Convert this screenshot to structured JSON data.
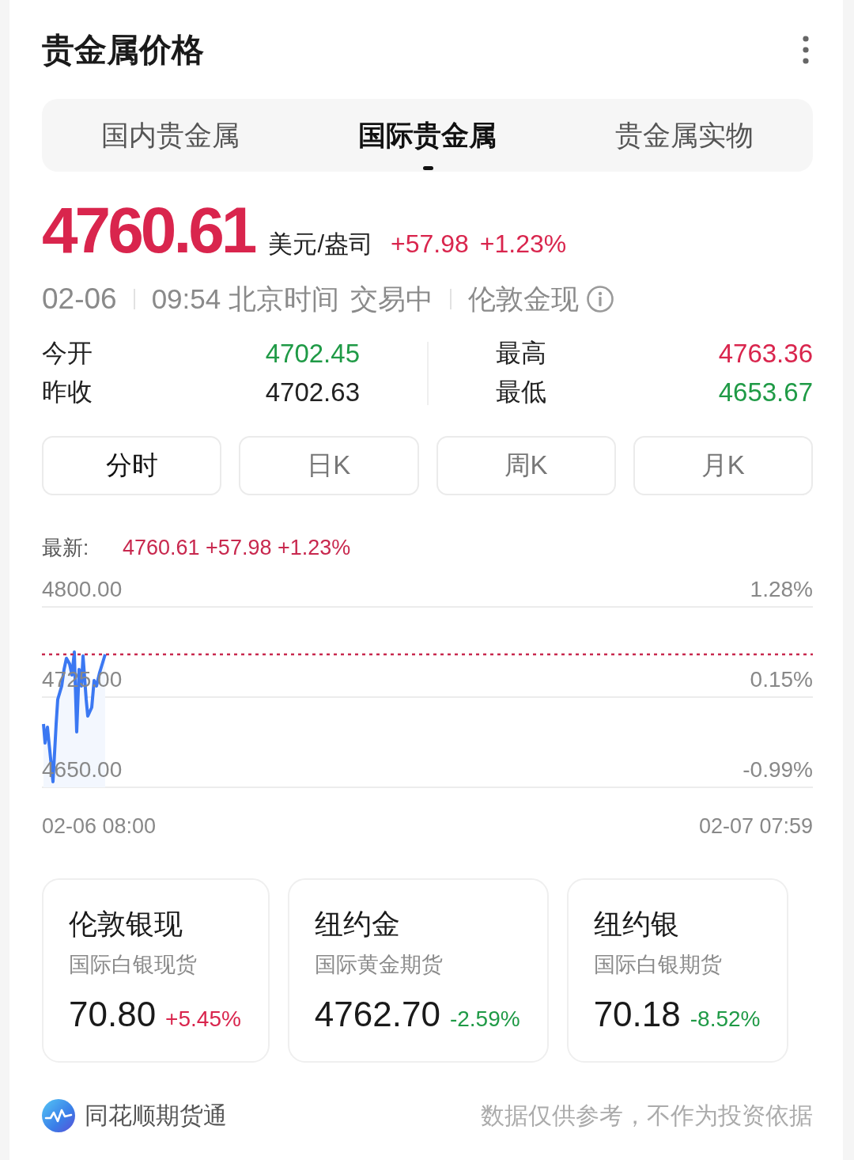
{
  "header": {
    "title": "贵金属价格"
  },
  "tabs": [
    {
      "label": "国内贵金属",
      "selected": false
    },
    {
      "label": "国际贵金属",
      "selected": true
    },
    {
      "label": "贵金属实物",
      "selected": false
    }
  ],
  "quote": {
    "price": "4760.61",
    "unit": "美元/盎司",
    "change": "+57.98",
    "change_percent": "+1.23%"
  },
  "status_line": {
    "date": "02-06",
    "time": "09:54 北京时间",
    "status": "交易中",
    "market": "伦敦金现"
  },
  "stat_columns": [
    {
      "items": [
        {
          "label": "今开",
          "value": "4702.45",
          "color": "#1f9a46"
        },
        {
          "label": "昨收",
          "value": "4702.63",
          "color": "#222222"
        }
      ]
    },
    {
      "items": [
        {
          "label": "最高",
          "value": "4763.36",
          "color": "#d9254d"
        },
        {
          "label": "最低",
          "value": "4653.67",
          "color": "#1f9a46"
        }
      ]
    }
  ],
  "periods": [
    {
      "label": "分时",
      "selected": true
    },
    {
      "label": "日K",
      "selected": false
    },
    {
      "label": "周K",
      "selected": false
    },
    {
      "label": "月K",
      "selected": false
    }
  ],
  "chart": {
    "latest_label": "最新:",
    "latest_value": "4760.61 +57.98 +1.23%",
    "price_axis_labels": [
      "4800.00",
      "4725.00",
      "4650.00"
    ],
    "percent_axis_labels": [
      "1.28%",
      "0.15%",
      "-0.99%"
    ],
    "time_axis_labels": [
      "02-06 08:00",
      "02-07 07:59"
    ]
  },
  "related": [
    {
      "name": "伦敦银现",
      "description": "国际白银现货",
      "price": "70.80",
      "change": "+5.45%",
      "color": "#d9254d"
    },
    {
      "name": "纽约金",
      "description": "国际黄金期货",
      "price": "4762.70",
      "change": "-2.59%",
      "color": "#1f9a46"
    },
    {
      "name": "纽约银",
      "description": "国际白银期货",
      "price": "70.18",
      "change": "-8.52%",
      "color": "#1f9a46"
    }
  ],
  "footer": {
    "brand": "同花顺期货通",
    "disclaimer": "数据仅供参考，不作为投资依据"
  }
}
